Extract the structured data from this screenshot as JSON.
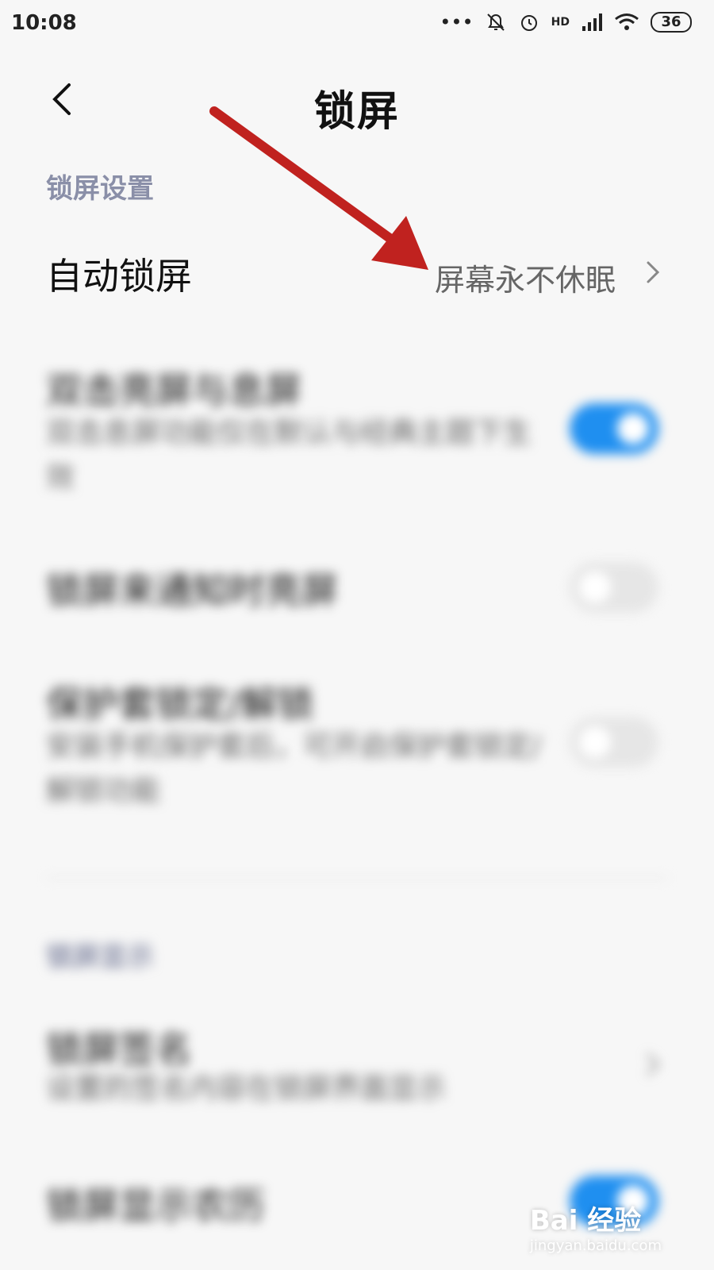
{
  "status_bar": {
    "time": "10:08",
    "network": "HD",
    "battery": "36"
  },
  "header": {
    "title": "锁屏"
  },
  "sections": {
    "lock_settings_header": "锁屏设置",
    "lock_display_header": "锁屏显示"
  },
  "auto_lock": {
    "title": "自动锁屏",
    "value": "屏幕永不休眠"
  },
  "blurred_rows": [
    {
      "title": "双击亮屏与息屏",
      "desc": "双击息屏功能仅在默认与经典主题下生效",
      "toggle": true
    },
    {
      "title": "锁屏来通知时亮屏",
      "toggle": false
    },
    {
      "title": "保护套锁定/解锁",
      "desc": "安装手机保护套后，可开启保护套锁定/解锁功能",
      "toggle": false
    },
    {
      "title": "锁屏签名",
      "desc": "设置的签名内容在锁屏界面显示"
    },
    {
      "title": "锁屏显示农历",
      "toggle": true
    }
  ],
  "watermark": {
    "brand": "Bai  经验",
    "url": "jingyan.baidu.com"
  },
  "colors": {
    "accent_blue": "#1f8ff0",
    "annotation_arrow": "#c0221f",
    "section_header": "#8a8fa8"
  }
}
